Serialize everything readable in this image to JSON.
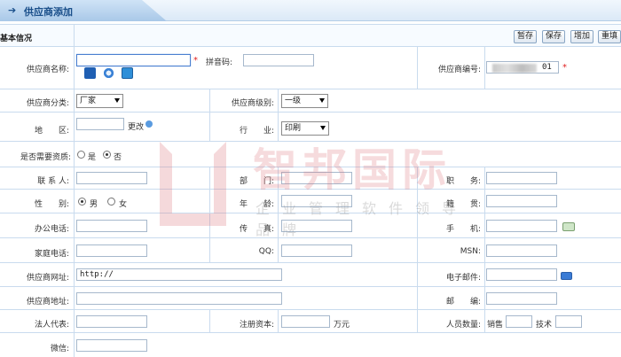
{
  "header": {
    "title": "供应商添加"
  },
  "section": {
    "title": "基本信况"
  },
  "toolbar": {
    "buttons": [
      "暂存",
      "保存",
      "增加",
      "重填"
    ]
  },
  "form": {
    "supplier_name": {
      "label": "供应商名称:",
      "value": ""
    },
    "pinyin_code": {
      "label": "拼音码:",
      "value": ""
    },
    "supplier_code": {
      "label": "供应商编号:",
      "value_suffix": "01"
    },
    "supplier_category": {
      "label": "供应商分类:",
      "value": "厂家"
    },
    "supplier_level": {
      "label": "供应商级别:",
      "value": "一级"
    },
    "region": {
      "label": "地　　区:",
      "value": "",
      "change_link": "更改"
    },
    "industry": {
      "label": "行　　业:",
      "value": "印刷"
    },
    "qualification": {
      "label": "是否需要资质:",
      "options": [
        "是",
        "否"
      ],
      "selected": "否"
    },
    "contact": {
      "label": "联 系 人:",
      "value": ""
    },
    "department": {
      "label": "部　　门:",
      "value": ""
    },
    "position": {
      "label": "职　　务:",
      "value": ""
    },
    "gender": {
      "label": "性　　别:",
      "options": [
        "男",
        "女"
      ],
      "selected": "男"
    },
    "age": {
      "label": "年　　龄:",
      "value": ""
    },
    "native_place": {
      "label": "籍　　贯:",
      "value": ""
    },
    "office_phone": {
      "label": "办公电话:",
      "value": ""
    },
    "fax": {
      "label": "传　　真:",
      "value": ""
    },
    "mobile": {
      "label": "手　　机:",
      "value": ""
    },
    "home_phone": {
      "label": "家庭电话:",
      "value": ""
    },
    "qq": {
      "label": "QQ:",
      "value": ""
    },
    "msn": {
      "label": "MSN:",
      "value": ""
    },
    "website": {
      "label": "供应商网址:",
      "value": "http://"
    },
    "email": {
      "label": "电子邮件:",
      "value": ""
    },
    "address": {
      "label": "供应商地址:",
      "value": ""
    },
    "postcode": {
      "label": "邮　　编:",
      "value": ""
    },
    "legal_rep": {
      "label": "法人代表:",
      "value": ""
    },
    "registered_capital": {
      "label": "注册资本:",
      "value": "",
      "unit": "万元"
    },
    "staff_count": {
      "label": "人员数量:",
      "sales_label": "销售",
      "tech_label": "技术"
    },
    "wechat": {
      "label": "微信:",
      "value": ""
    }
  },
  "watermark": {
    "brand": "智邦国际",
    "tagline": "企业管理软件领导品牌"
  },
  "colors": {
    "accent": "#1a4f8a",
    "border": "#c9dbee",
    "required": "#e02020"
  }
}
